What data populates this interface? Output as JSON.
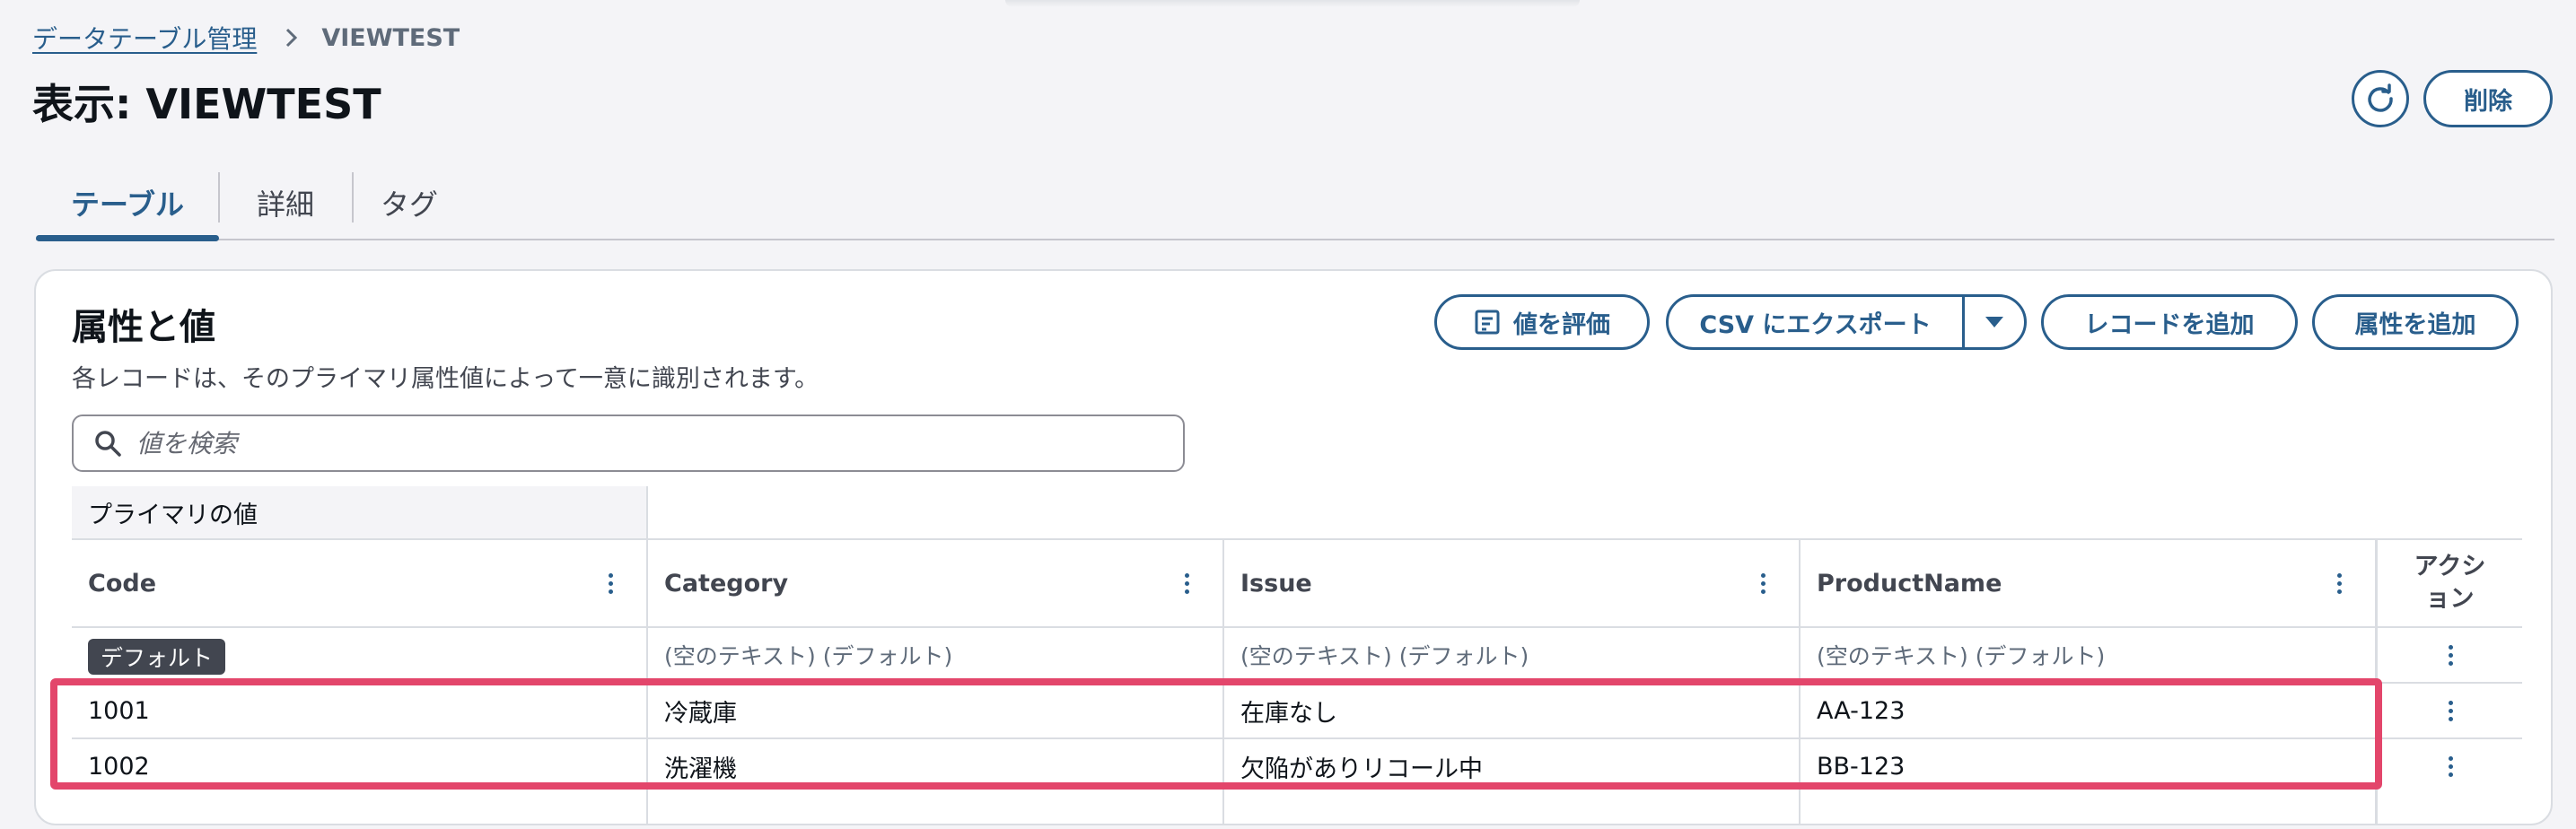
{
  "breadcrumb": {
    "parent": "データテーブル管理",
    "current": "VIEWTEST"
  },
  "page": {
    "title": "表示: VIEWTEST",
    "delete_label": "削除"
  },
  "tabs": [
    {
      "label": "テーブル",
      "active": true
    },
    {
      "label": "詳細",
      "active": false
    },
    {
      "label": "タグ",
      "active": false
    }
  ],
  "section": {
    "title": "属性と値",
    "description": "各レコードは、そのプライマリ属性値によって一意に識別されます。",
    "evaluate_label": "値を評価",
    "export_label": "CSV にエクスポート",
    "add_record_label": "レコードを追加",
    "add_attribute_label": "属性を追加"
  },
  "search": {
    "placeholder": "値を検索"
  },
  "table": {
    "group_header": "プライマリの値",
    "columns": [
      "Code",
      "Category",
      "Issue",
      "ProductName"
    ],
    "action_header": "アクション",
    "default_row": {
      "badge": "デフォルト",
      "values": [
        "(空のテキスト) (デフォルト)",
        "(空のテキスト) (デフォルト)",
        "(空のテキスト) (デフォルト)"
      ]
    },
    "rows": [
      [
        "1001",
        "冷蔵庫",
        "在庫なし",
        "AA-123"
      ],
      [
        "1002",
        "洗濯機",
        "欠陥がありリコール中",
        "BB-123"
      ]
    ]
  },
  "colors": {
    "accent": "#295e8c",
    "highlight": "#e3466b"
  },
  "icons": [
    "chevron-right-icon",
    "refresh-icon",
    "evaluate-icon",
    "caret-down-icon",
    "search-icon",
    "more-vertical-icon"
  ]
}
